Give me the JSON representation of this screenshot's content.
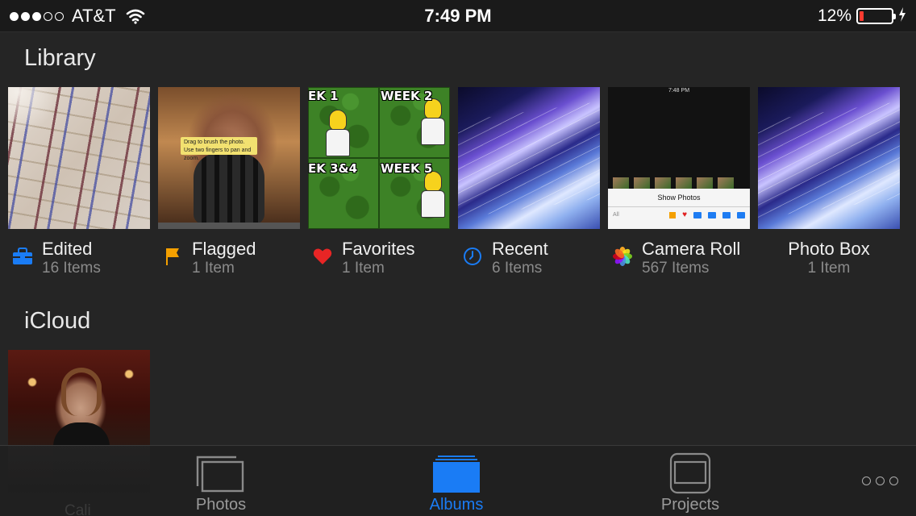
{
  "status_bar": {
    "carrier": "AT&T",
    "time": "7:49 PM",
    "battery_percent": "12%",
    "battery_level": 0.12,
    "signal_filled": 3,
    "signal_total": 5
  },
  "library": {
    "title": "Library",
    "albums": [
      {
        "name": "Edited",
        "count": "16 Items",
        "icon": "toolbox-icon"
      },
      {
        "name": "Flagged",
        "count": "1 Item",
        "icon": "flag-icon"
      },
      {
        "name": "Favorites",
        "count": "1 Item",
        "icon": "heart-icon"
      },
      {
        "name": "Recent",
        "count": "6 Items",
        "icon": "clock-icon"
      },
      {
        "name": "Camera Roll",
        "count": "567 Items",
        "icon": "photos-flower-icon"
      },
      {
        "name": "Photo Box",
        "count": "1 Item",
        "icon": ""
      }
    ]
  },
  "thumbnails": {
    "flagged_hint": "Drag to brush the photo. Use two fingers to pan and zoom.",
    "favorites_labels": [
      "EK 1",
      "WEEK 2",
      "EK 3&4",
      "WEEK 5"
    ],
    "camera_roll_time": "7:48 PM",
    "camera_roll_sheet_title": "Show Photos",
    "camera_roll_sheet_filter": "All"
  },
  "icloud": {
    "title": "iCloud",
    "albums": [
      {
        "name": "Cali",
        "count": ""
      }
    ]
  },
  "tab_bar": {
    "tabs": [
      {
        "label": "Photos",
        "icon": "photos-stack-icon",
        "active": false
      },
      {
        "label": "Albums",
        "icon": "albums-stack-icon",
        "active": true
      },
      {
        "label": "Projects",
        "icon": "projects-icon",
        "active": false
      }
    ],
    "more_icon": "more-dots-icon"
  },
  "colors": {
    "accent": "#1a7cf5",
    "background": "#252525",
    "battery_low": "#ff3b30",
    "flag": "#f4a000",
    "heart": "#e82525"
  }
}
